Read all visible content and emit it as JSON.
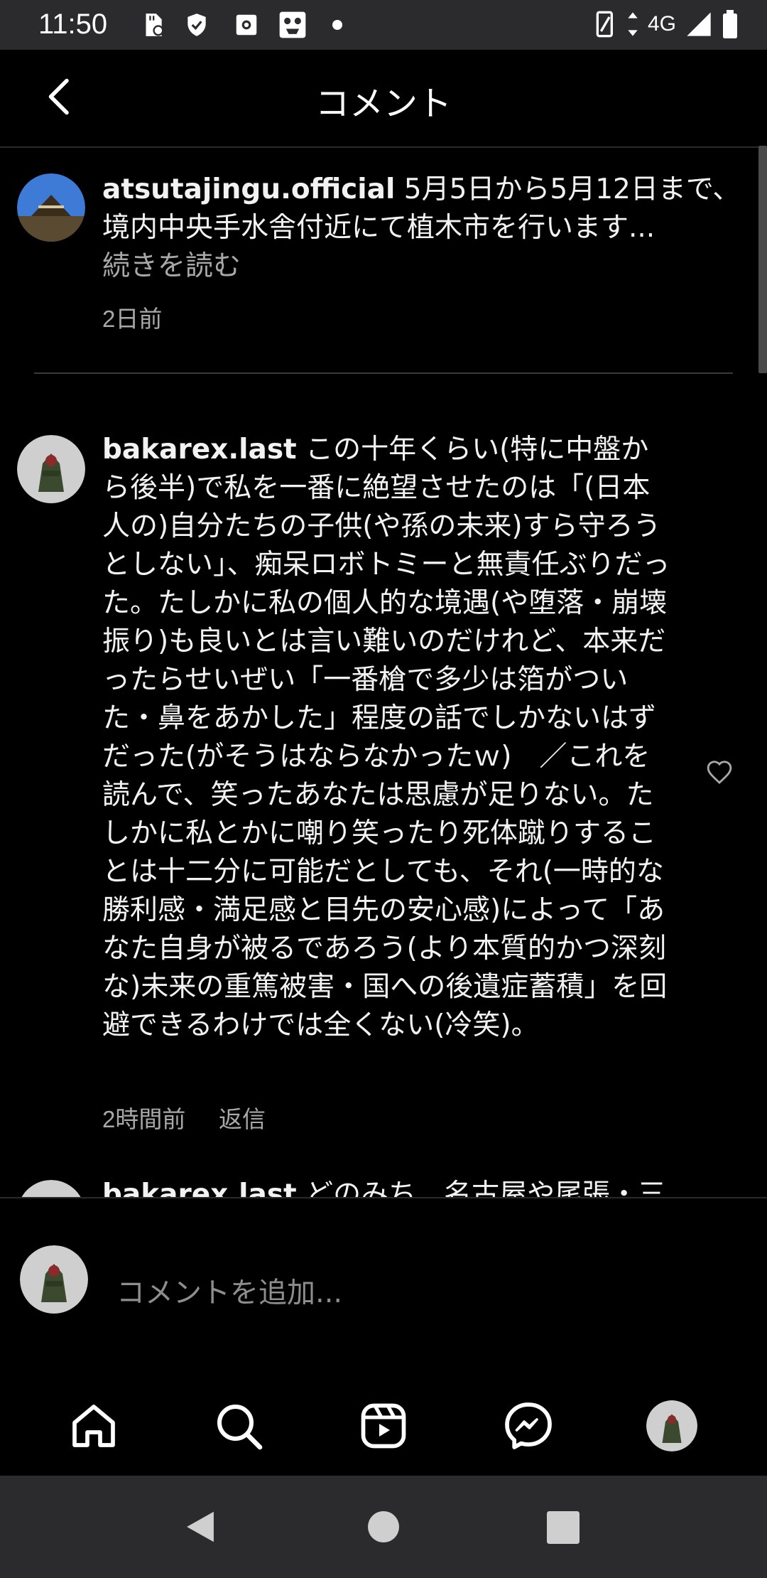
{
  "status_bar": {
    "time": "11:50",
    "network": "4G",
    "icons": [
      "sd-card-icon",
      "shield-icon",
      "settings-icon",
      "game-icon",
      "dot-icon",
      "vibrate-icon",
      "signal-icon",
      "battery-icon"
    ]
  },
  "header": {
    "title": "コメント",
    "back_icon": "chevron-left-icon"
  },
  "caption": {
    "username": "atsutajingu.official",
    "text": " 5月5日から5月12日まで、境内中央手水舎付近にて植木市を行います...",
    "read_more": "続きを読む",
    "time": "2日前"
  },
  "comments": [
    {
      "username": "bakarex.last",
      "text": " この十年くらい(特に中盤から後半)で私を一番に絶望させたのは「(日本人の)自分たちの子供(や孫の未来)すら守ろうとしない」、痴呆ロボトミーと無責任ぶりだった。たしかに私の個人的な境遇(や堕落・崩壊振り)も良いとは言い難いのだけれど、本来だったらせいぜい「一番槍で多少は箔がついた・鼻をあかした」程度の話でしかないはずだった(がそうはならなかったｗ)　／これを読んで、笑ったあなたは思慮が足りない。たしかに私とかに嘲り笑ったり死体蹴りすることは十二分に可能だとしても、それ(一時的な勝利感・満足感と目先の安心感)によって「あなた自身が被るであろう(より本質的かつ深刻な)未来の重篤被害・国への後遺症蓄積」を回避できるわけでは全くない(冷笑)。",
      "time": "2時間前",
      "reply": "返信"
    },
    {
      "username": "bakarex.last",
      "text": " どのみち、名古屋や尾張・三"
    }
  ],
  "add_comment": {
    "placeholder": "コメントを追加..."
  },
  "bottom_nav": [
    "home-icon",
    "search-icon",
    "reels-icon",
    "messenger-icon",
    "profile-avatar"
  ],
  "colors": {
    "background": "#000000",
    "status_bar": "#2b2b2e",
    "muted_text": "#a8a8a8"
  }
}
